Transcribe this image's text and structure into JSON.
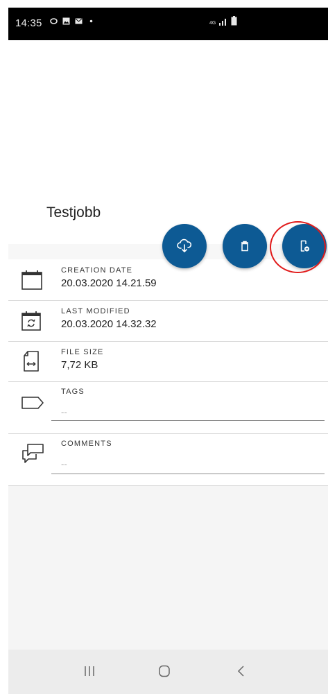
{
  "status_bar": {
    "time": "14:35",
    "left_icons": [
      "notification-ring-icon",
      "gallery-icon",
      "mail-icon",
      "dot-icon"
    ],
    "network_label": "4G",
    "right_icons": [
      "signal-icon",
      "battery-icon"
    ]
  },
  "job": {
    "title": "Testjobb"
  },
  "actions": {
    "download_icon": "cloud-download-icon",
    "delete_icon": "trash-icon",
    "send_to_device_icon": "device-send-icon",
    "accent_color": "#0d5a94",
    "highlight_color": "#e11a1a"
  },
  "details": {
    "creation": {
      "label": "CREATION DATE",
      "value": "20.03.2020 14.21.59",
      "icon": "calendar-icon"
    },
    "modified": {
      "label": "LAST MODIFIED",
      "value": "20.03.2020 14.32.32",
      "icon": "calendar-sync-icon"
    },
    "size": {
      "label": "FILE SIZE",
      "value": "7,72 KB",
      "icon": "file-size-icon"
    },
    "tags": {
      "label": "TAGS",
      "placeholder": "--",
      "icon": "tag-icon"
    },
    "comments": {
      "label": "COMMENTS",
      "placeholder": "--",
      "icon": "comments-icon"
    }
  },
  "nav_bar": {
    "recent_icon": "recent-apps-icon",
    "home_icon": "home-icon",
    "back_icon": "back-icon"
  }
}
